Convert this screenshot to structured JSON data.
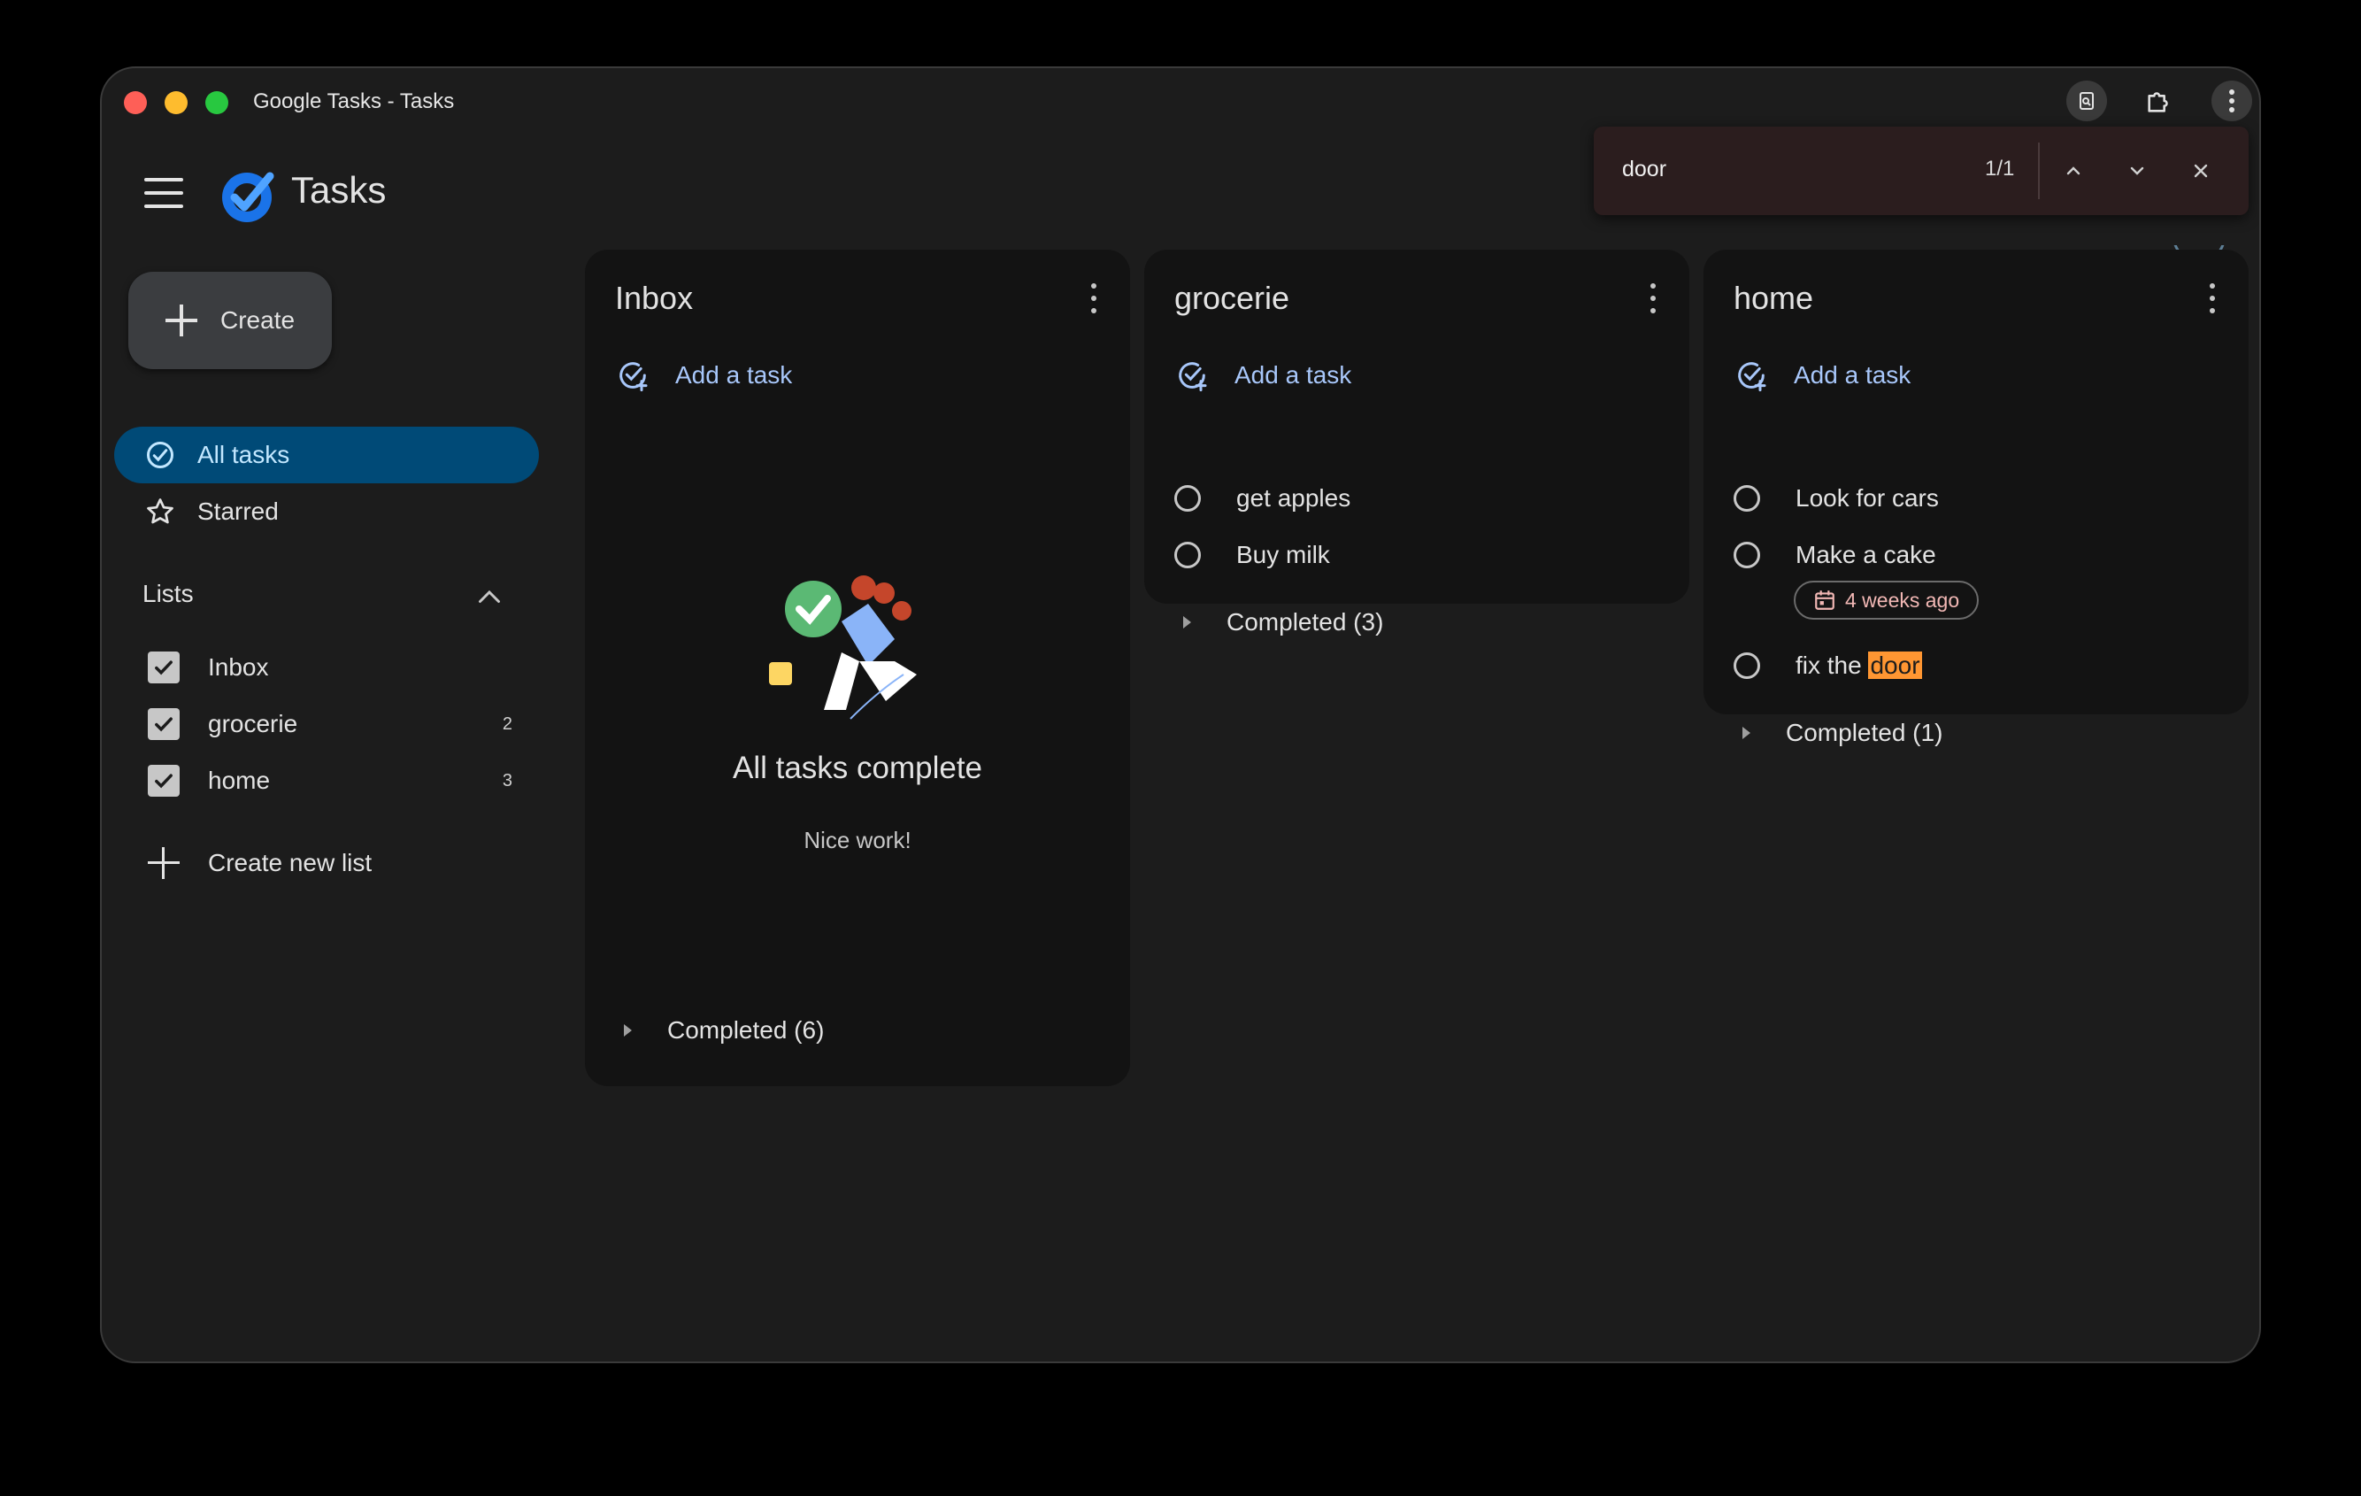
{
  "window": {
    "title": "Google Tasks - Tasks"
  },
  "header": {
    "app_name": "Tasks"
  },
  "find": {
    "query": "door",
    "count": "1/1"
  },
  "sidebar": {
    "create_label": "Create",
    "nav": [
      {
        "label": "All tasks",
        "icon": "check-circle-icon",
        "active": true
      },
      {
        "label": "Starred",
        "icon": "star-icon",
        "active": false
      }
    ],
    "lists_heading": "Lists",
    "lists": [
      {
        "label": "Inbox",
        "count": "",
        "checked": true
      },
      {
        "label": "grocerie",
        "count": "2",
        "checked": true
      },
      {
        "label": "home",
        "count": "3",
        "checked": true
      }
    ],
    "new_list_label": "Create new list"
  },
  "columns": [
    {
      "title": "Inbox",
      "add_task_label": "Add a task",
      "empty_title": "All tasks complete",
      "empty_subtitle": "Nice work!",
      "completed_label": "Completed (6)"
    },
    {
      "title": "grocerie",
      "add_task_label": "Add a task",
      "tasks": [
        "get apples",
        "Buy milk"
      ],
      "completed_label": "Completed (3)"
    },
    {
      "title": "home",
      "add_task_label": "Add a task",
      "tasks": [
        "Look for cars",
        "Make a cake"
      ],
      "task3_prefix": "fix the ",
      "task3_match": "door",
      "date_chip": "4 weeks ago",
      "completed_label": "Completed (1)"
    }
  ],
  "colors": {
    "accent_active_bg": "#004a77",
    "link_blue": "#a8c7fa",
    "find_highlight": "#ff9632",
    "date_chip_text": "#f2b8b5"
  }
}
